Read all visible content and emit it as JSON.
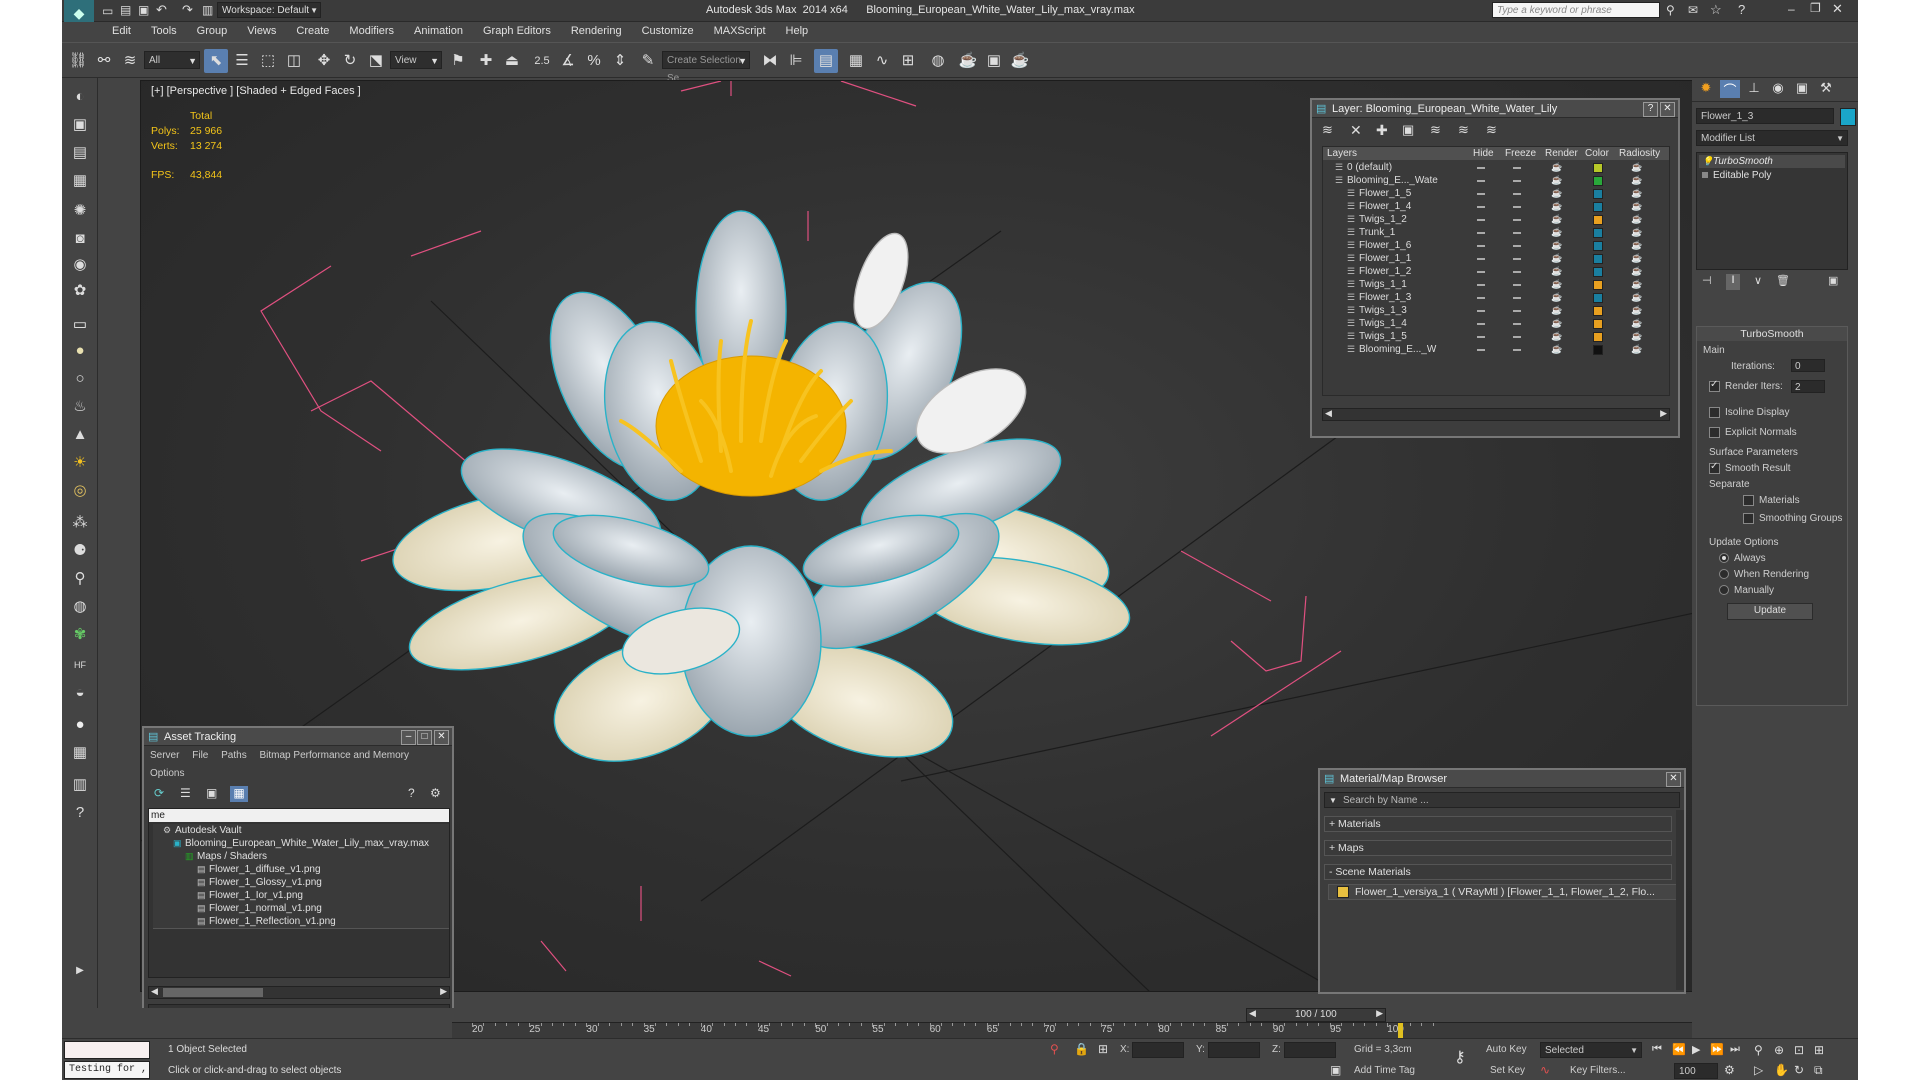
{
  "app": {
    "title": "Autodesk 3ds Max  2014 x64      Blooming_European_White_Water_Lily_max_vray.max",
    "workspace": "Workspace: Default",
    "search_placeholder": "Type a keyword or phrase"
  },
  "menu": [
    "Edit",
    "Tools",
    "Group",
    "Views",
    "Create",
    "Modifiers",
    "Animation",
    "Graph Editors",
    "Rendering",
    "Customize",
    "MAXScript",
    "Help"
  ],
  "toolbar": {
    "filter_value": "All",
    "refcoord_value": "View",
    "snap_label": "2.5",
    "selection_set_placeholder": "Create Selection Se"
  },
  "viewport": {
    "label": "[+] [Perspective ] [Shaded + Edged Faces ]",
    "stats": {
      "total_label": "Total",
      "polys_label": "Polys:",
      "polys_value": "25 966",
      "verts_label": "Verts:",
      "verts_value": "13 274",
      "fps_label": "FPS:",
      "fps_value": "43,844"
    }
  },
  "layer_panel": {
    "title": "Layer: Blooming_European_White_Water_Lily",
    "columns": [
      "Layers",
      "Hide",
      "Freeze",
      "Render",
      "Color",
      "Radiosity"
    ],
    "rows": [
      {
        "name": "0 (default)",
        "color": "#b7c828",
        "indent": 1
      },
      {
        "name": "Blooming_E..._Wate",
        "color": "#29a83a",
        "indent": 1
      },
      {
        "name": "Flower_1_5",
        "color": "#1a7fa0",
        "indent": 2
      },
      {
        "name": "Flower_1_4",
        "color": "#1a7fa0",
        "indent": 2
      },
      {
        "name": "Twigs_1_2",
        "color": "#e8a020",
        "indent": 2
      },
      {
        "name": "Trunk_1",
        "color": "#1a7fa0",
        "indent": 2
      },
      {
        "name": "Flower_1_6",
        "color": "#1a7fa0",
        "indent": 2
      },
      {
        "name": "Flower_1_1",
        "color": "#1a7fa0",
        "indent": 2
      },
      {
        "name": "Flower_1_2",
        "color": "#1a7fa0",
        "indent": 2
      },
      {
        "name": "Twigs_1_1",
        "color": "#e8a020",
        "indent": 2
      },
      {
        "name": "Flower_1_3",
        "color": "#1a7fa0",
        "indent": 2
      },
      {
        "name": "Twigs_1_3",
        "color": "#e8a020",
        "indent": 2
      },
      {
        "name": "Twigs_1_4",
        "color": "#e8a020",
        "indent": 2
      },
      {
        "name": "Twigs_1_5",
        "color": "#e8a020",
        "indent": 2
      },
      {
        "name": "Blooming_E..._W",
        "color": "#111111",
        "indent": 2
      }
    ]
  },
  "asset_panel": {
    "title": "Asset Tracking",
    "menu": [
      "Server",
      "File",
      "Paths",
      "Bitmap Performance and Memory"
    ],
    "options_label": "Options",
    "header": "me",
    "rows": [
      {
        "name": "Autodesk Vault",
        "indent": 1
      },
      {
        "name": "Blooming_European_White_Water_Lily_max_vray.max",
        "indent": 2
      },
      {
        "name": "Maps / Shaders",
        "indent": 3
      },
      {
        "name": "Flower_1_diffuse_v1.png",
        "indent": 4
      },
      {
        "name": "Flower_1_Glossy_v1.png",
        "indent": 4
      },
      {
        "name": "Flower_1_Ior_v1.png",
        "indent": 4
      },
      {
        "name": "Flower_1_normal_v1.png",
        "indent": 4
      },
      {
        "name": "Flower_1_Reflection_v1.png",
        "indent": 4
      }
    ]
  },
  "material_panel": {
    "title": "Material/Map Browser",
    "search_placeholder": "Search by Name ...",
    "sections": [
      "+ Materials",
      "+ Maps",
      "- Scene Materials"
    ],
    "material": "Flower_1_versiya_1  ( VRayMtl )  [Flower_1_1, Flower_1_2, Flo..."
  },
  "command_panel": {
    "object_name": "Flower_1_3",
    "modifier_list": "Modifier List",
    "stack": [
      "TurboSmooth",
      "Editable Poly"
    ],
    "rollout_title": "TurboSmooth",
    "main_label": "Main",
    "iterations_label": "Iterations:",
    "iterations_value": "0",
    "render_iters_label": "Render Iters:",
    "render_iters_value": "2",
    "isoline_label": "Isoline Display",
    "explicit_normals_label": "Explicit Normals",
    "surface_params_label": "Surface Parameters",
    "smooth_result_label": "Smooth Result",
    "separate_label": "Separate",
    "materials_label": "Materials",
    "smoothing_groups_label": "Smoothing Groups",
    "update_options_label": "Update Options",
    "always_label": "Always",
    "when_rendering_label": "When Rendering",
    "manually_label": "Manually",
    "update_button": "Update"
  },
  "timeline": {
    "frame_display": "100 / 100",
    "ticks": [
      "20",
      "25",
      "30",
      "35",
      "40",
      "45",
      "50",
      "55",
      "60",
      "65",
      "70",
      "75",
      "80",
      "85",
      "90",
      "95",
      "100"
    ]
  },
  "status": {
    "maxscript_text": "Testing for ,",
    "selected_text": "1 Object Selected",
    "prompt_text": "Click or click-and-drag to select objects",
    "x_label": "X:",
    "y_label": "Y:",
    "z_label": "Z:",
    "grid_text": "Grid = 3,3cm",
    "add_time_tag": "Add Time Tag",
    "auto_key": "Auto Key",
    "set_key": "Set Key",
    "selected_dropdown": "Selected",
    "key_filters": "Key Filters...",
    "frame_value": "100"
  }
}
